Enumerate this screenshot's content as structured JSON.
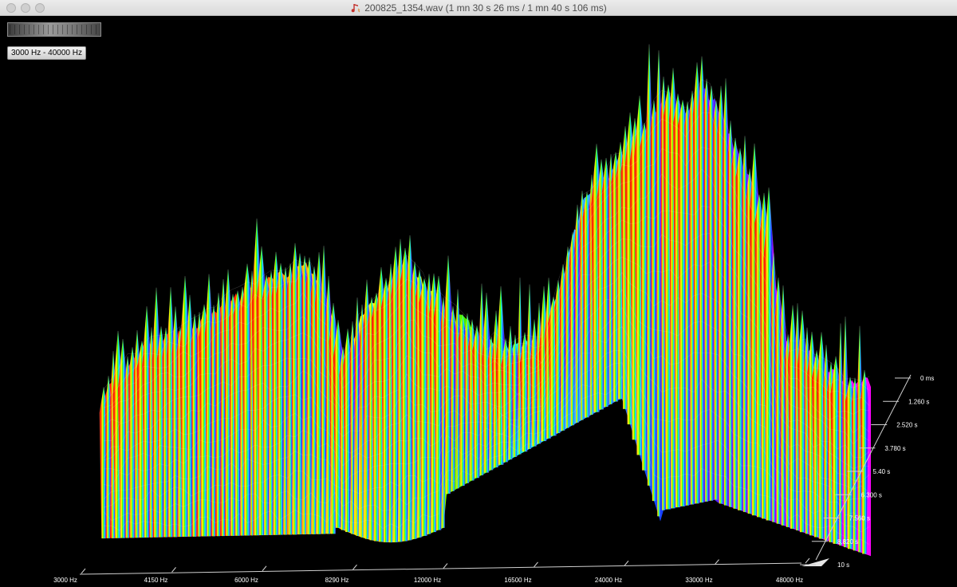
{
  "window": {
    "title": "200825_1354.wav (1 mn 30 s 26 ms / 1 mn 40 s 106 ms)",
    "icon": "audio-file-icon"
  },
  "controls": {
    "range_button_label": "3000 Hz - 40000 Hz",
    "level_meter_icon": "level-meter"
  },
  "axes": {
    "frequency_ticks": [
      "3000 Hz",
      "4150 Hz",
      "6000 Hz",
      "8290 Hz",
      "12000 Hz",
      "16500 Hz",
      "24000 Hz",
      "33000 Hz",
      "48000 Hz"
    ],
    "time_ticks": [
      "0 ms",
      "1.260 s",
      "2.520 s",
      "3.780 s",
      "5.40 s",
      "6.300 s",
      "7.560 s",
      "8.820 s",
      "10 s"
    ]
  },
  "colors": {
    "background": "#000000",
    "spectrum_gradient": [
      "#ff1a00",
      "#ff8c00",
      "#ffee00",
      "#b8ff00",
      "#22ee00",
      "#00ffee",
      "#33aaff",
      "#1133ff",
      "#8800ff",
      "#ff00ff"
    ]
  }
}
